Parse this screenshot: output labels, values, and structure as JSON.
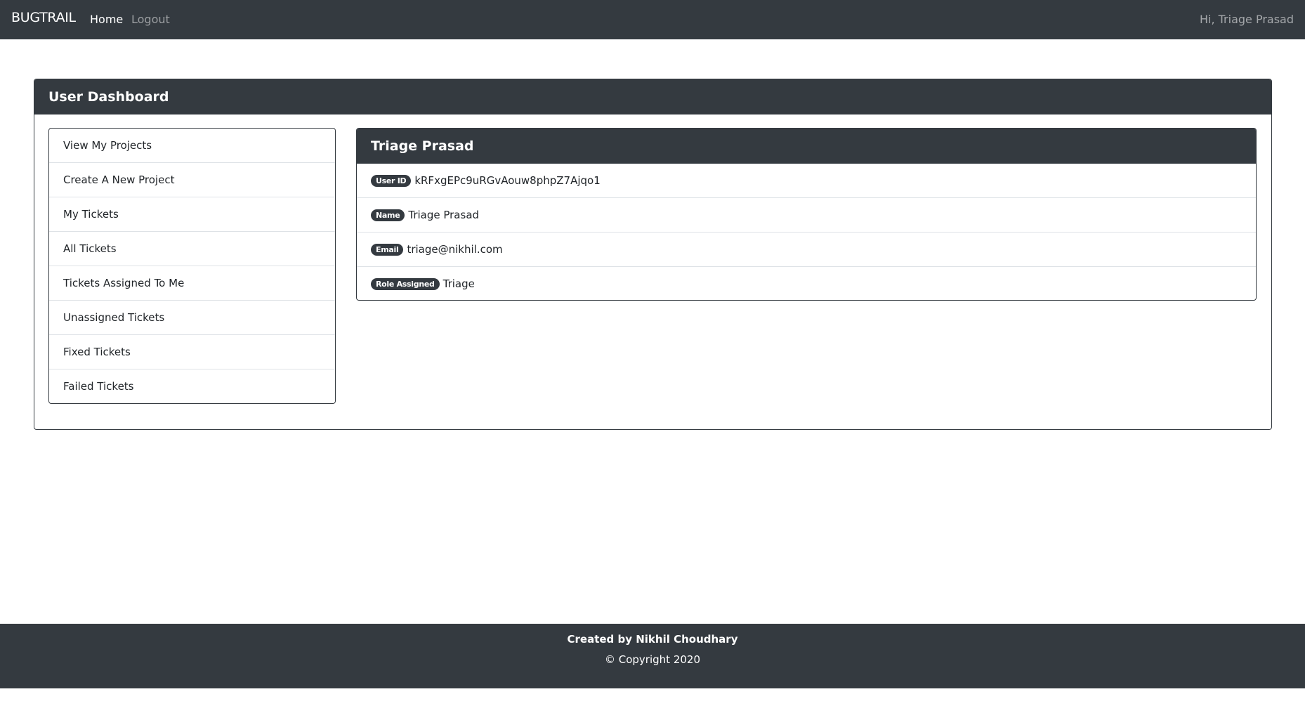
{
  "navbar": {
    "brand": "BUGTRAIL",
    "links": [
      {
        "label": "Home",
        "active": true
      },
      {
        "label": "Logout",
        "active": false
      }
    ],
    "greeting": "Hi, Triage Prasad"
  },
  "dashboard": {
    "title": "User Dashboard",
    "menu": [
      {
        "label": "View My Projects"
      },
      {
        "label": "Create A New Project"
      },
      {
        "label": "My Tickets"
      },
      {
        "label": "All Tickets"
      },
      {
        "label": "Tickets Assigned To Me"
      },
      {
        "label": "Unassigned Tickets"
      },
      {
        "label": "Fixed Tickets"
      },
      {
        "label": "Failed Tickets"
      }
    ],
    "profile": {
      "title": "Triage Prasad",
      "rows": [
        {
          "badge": "User ID",
          "value": "kRFxgEPc9uRGvAouw8phpZ7Ajqo1"
        },
        {
          "badge": "Name",
          "value": "Triage Prasad"
        },
        {
          "badge": "Email",
          "value": "triage@nikhil.com"
        },
        {
          "badge": "Role Assigned",
          "value": "Triage"
        }
      ]
    }
  },
  "footer": {
    "credit": "Created by Nikhil Choudhary",
    "copyright": "© Copyright 2020"
  },
  "colors": {
    "dark": "#343a40",
    "border_light": "#dee2e6",
    "text": "#212529"
  }
}
